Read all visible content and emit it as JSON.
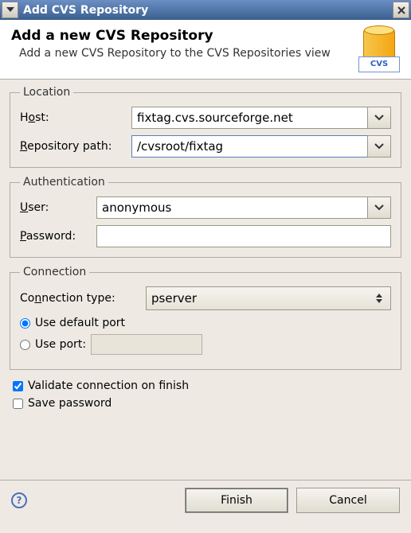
{
  "titlebar": {
    "title": "Add CVS Repository"
  },
  "banner": {
    "title": "Add a new CVS Repository",
    "subtitle": "Add a new CVS Repository to the CVS Repositories view",
    "icon_label": "CVS"
  },
  "location": {
    "legend": "Location",
    "host_label_pre": "H",
    "host_label_u": "o",
    "host_label_post": "st:",
    "host_value": "fixtag.cvs.sourceforge.net",
    "repo_label_pre": "",
    "repo_label_u": "R",
    "repo_label_post": "epository path:",
    "repo_value": "/cvsroot/fixtag"
  },
  "auth": {
    "legend": "Authentication",
    "user_label_pre": "",
    "user_label_u": "U",
    "user_label_post": "ser:",
    "user_value": "anonymous",
    "pass_label_pre": "",
    "pass_label_u": "P",
    "pass_label_post": "assword:",
    "pass_value": ""
  },
  "conn": {
    "legend": "Connection",
    "type_label_pre": "Co",
    "type_label_u": "n",
    "type_label_post": "nection type:",
    "type_value": "pserver",
    "default_port_pre": "Use default p",
    "default_port_u": "o",
    "default_port_post": "rt",
    "use_port_pre": "Use por",
    "use_port_u": "t",
    "use_port_post": ":"
  },
  "options": {
    "validate_pre": "",
    "validate_u": "V",
    "validate_post": "alidate connection on finish",
    "save_pre": "",
    "save_u": "S",
    "save_post": "ave password"
  },
  "footer": {
    "finish_pre": "",
    "finish_u": "F",
    "finish_post": "inish",
    "cancel": "Cancel"
  }
}
